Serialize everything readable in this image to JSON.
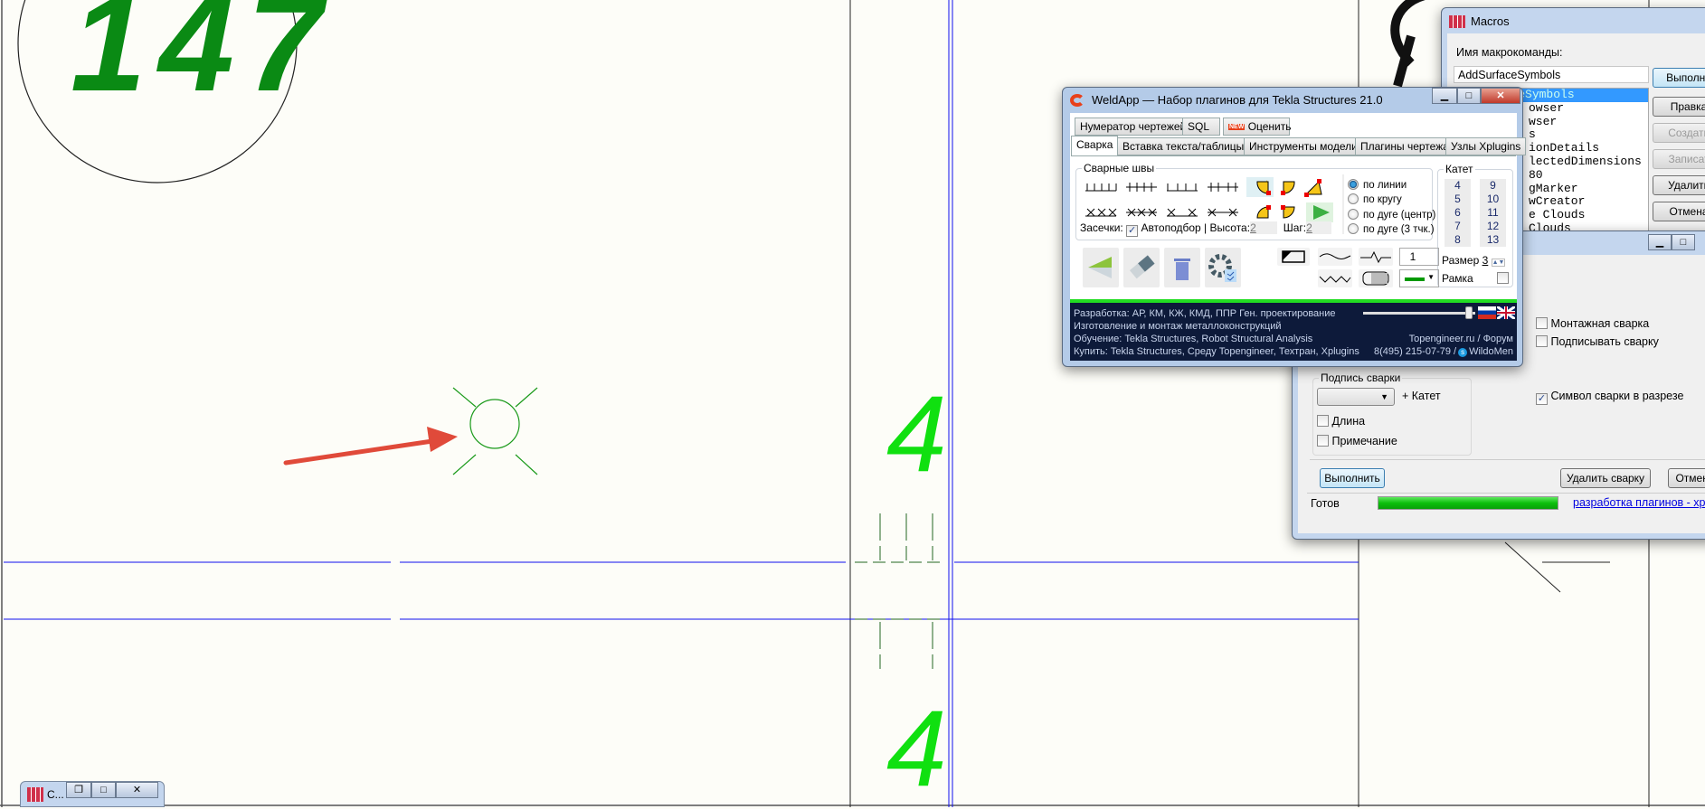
{
  "drawing": {
    "label_top": "147",
    "label_four_1": "4",
    "label_four_2": "4"
  },
  "weldapp": {
    "title": "WeldApp — Набор плагинов для Tekla Structures 21.0",
    "tabs_row1": [
      "Нумератор чертежей",
      "SQL",
      "Оценить"
    ],
    "new_badge": "NEW",
    "tabs_row2": [
      "Сварка",
      "Вставка текста/таблицы",
      "Инструменты модели",
      "Плагины чертежа",
      "Узлы Xplugins"
    ],
    "active_tab": "Сварка",
    "welds_group": "Сварные швы",
    "notches_label": "Засечки:",
    "notches_checked": true,
    "autoselect_label": "Автоподбор |",
    "height_label": "Высота:",
    "height_value": "2",
    "step_label": "Шаг:",
    "step_value": "2",
    "modes": [
      "по линии",
      "по кругу",
      "по дуге (центр)",
      "по дуге (3 тчк.)"
    ],
    "selected_mode": "по линии",
    "katet_group": "Катет",
    "katet_col1": [
      "4",
      "5",
      "6",
      "7",
      "8"
    ],
    "katet_col2": [
      "9",
      "10",
      "11",
      "12",
      "13"
    ],
    "size_label": "Размер",
    "size_value": "3",
    "frame_label": "Рамка",
    "line_spinner_value": "1",
    "line_color": "#009900",
    "footer": {
      "line1": "Разработка: АР, КМ, КЖ, КМД, ППР Ген. проектирование",
      "line2": "Изготовление и монтаж металлоконструкций",
      "line3": "Обучение: Tekla Structures, Robot Structural Analysis",
      "line4": "Купить: Tekla Structures, Среду Topengineer, Техтран, Xplugins",
      "site": "Topengineer.ru / Форум",
      "phone": "8(495) 215-07-79 /",
      "skype": "WildoMen",
      "slider_value": 0.97
    }
  },
  "macros": {
    "title": "Macros",
    "name_label": "Имя макрокоманды:",
    "name_value": "AddSurfaceSymbols",
    "list": [
      "AddSurfaceSymbols",
      "owser",
      "wser",
      "s",
      "ionDetails",
      "lectedDimensions",
      "80",
      "gMarker",
      "wCreator",
      "e Clouds",
      "Clouds"
    ],
    "buttons": [
      "Выполни",
      "Правка",
      "Создать",
      "Записат",
      "Удалить",
      "Отмена"
    ]
  },
  "weld_dialog": {
    "montage_label": "Монтажная сварка",
    "montage_checked": false,
    "sign_label": "Подписывать сварку",
    "sign_checked": false,
    "caption_group": "Подпись сварки",
    "plus_katet": "+ Катет",
    "length_label": "Длина",
    "length_checked": false,
    "note_label": "Примечание",
    "note_checked": false,
    "section_symbol_label": "Символ сварки в разрезе",
    "section_symbol_checked": true,
    "run_button": "Выполнить",
    "delete_button": "Удалить сварку",
    "cancel_button": "Отмена",
    "status": "Готов",
    "progress": 1.0,
    "link": "разработка плагинов - xplugins"
  },
  "minimized_window": {
    "title": "C..."
  }
}
